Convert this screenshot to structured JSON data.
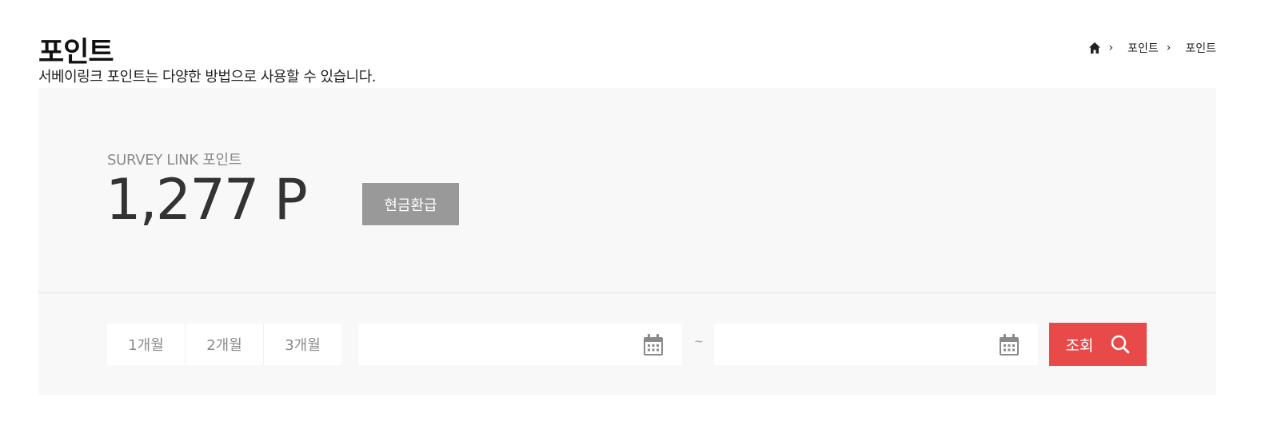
{
  "header": {
    "title": "포인트",
    "subtitle": "서베이링크 포인트는 다양한 방법으로 사용할 수 있습니다."
  },
  "breadcrumb": {
    "home_icon": "home-icon",
    "items": [
      "포인트",
      "포인트"
    ],
    "separator": "›"
  },
  "points": {
    "label": "SURVEY LINK 포인트",
    "value": "1,277 P",
    "refund_label": "현금환급"
  },
  "filter": {
    "period_tabs": [
      "1개월",
      "2개월",
      "3개월"
    ],
    "start_date": {
      "value": "",
      "icon": "calendar-icon"
    },
    "range_separator": "~",
    "end_date": {
      "value": "",
      "icon": "calendar-icon"
    },
    "search_label": "조회",
    "search_icon": "search-icon"
  },
  "colors": {
    "panel_bg": "#f8f8f8",
    "refund_button": "#999999",
    "search_button": "#e84a4a"
  }
}
